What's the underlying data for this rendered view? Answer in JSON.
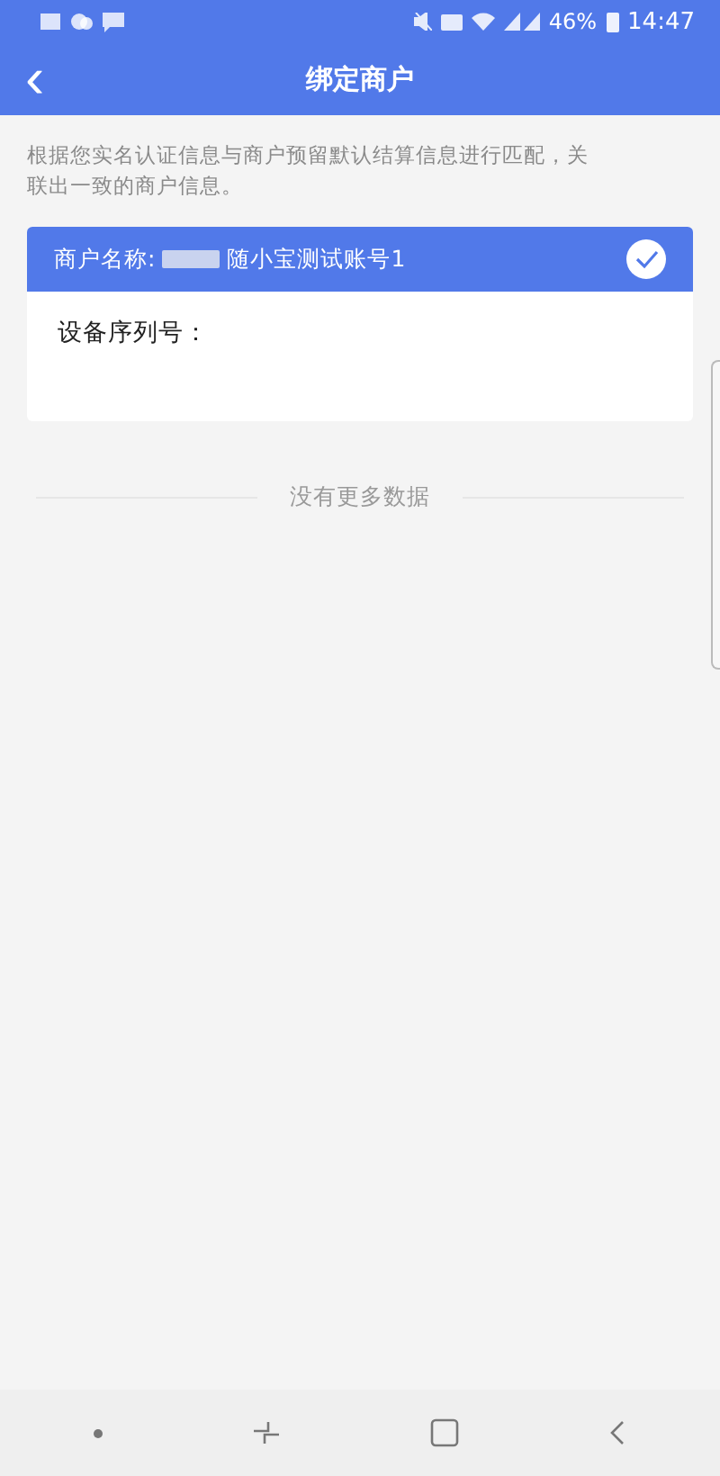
{
  "status_bar": {
    "battery": "46%",
    "time": "14:47"
  },
  "header": {
    "back": "‹",
    "title": "绑定商户"
  },
  "description": "根据您实名认证信息与商户预留默认结算信息进行匹配，关联出一致的商户信息。",
  "merchants": [
    {
      "name_label": "商户名称:",
      "name_value": "随小宝测试账号1",
      "redacted": true,
      "selected": true,
      "serial_label": "设备序列号："
    }
  ],
  "end_text": "没有更多数据"
}
